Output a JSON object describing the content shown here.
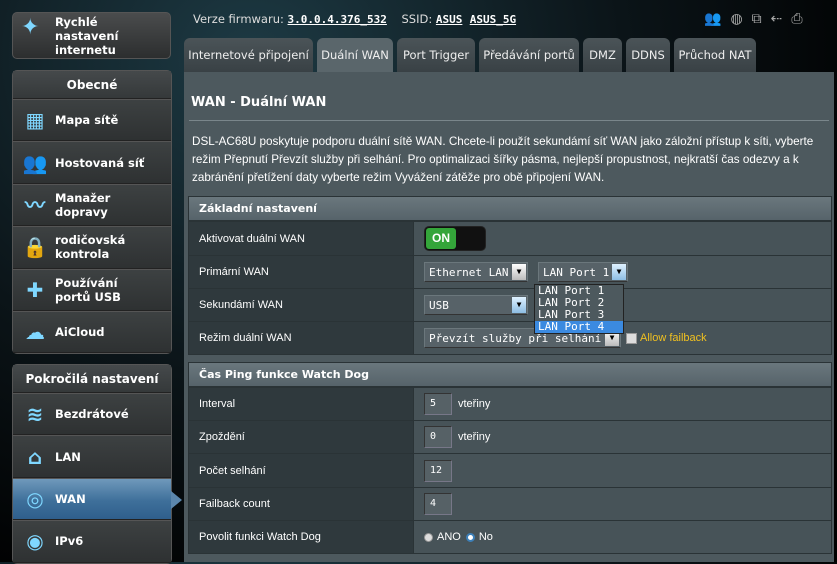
{
  "quick_setup": {
    "label": "Rychlé nastavení internetu",
    "icon": "magic-wand-icon"
  },
  "general": {
    "header": "Obecné",
    "items": [
      {
        "label": "Mapa sítě",
        "icon": "network-map-icon"
      },
      {
        "label": "Hostovaná síť",
        "icon": "guest-network-icon"
      },
      {
        "label": "Manažer dopravy",
        "icon": "traffic-manager-icon"
      },
      {
        "label": "rodičovská kontrola",
        "icon": "lock-icon"
      },
      {
        "label": "Používání portů USB",
        "icon": "puzzle-icon"
      },
      {
        "label": "AiCloud",
        "icon": "cloud-icon"
      }
    ]
  },
  "advanced": {
    "header": "Pokročilá nastavení",
    "items": [
      {
        "label": "Bezdrátové",
        "icon": "wifi-icon"
      },
      {
        "label": "LAN",
        "icon": "home-icon"
      },
      {
        "label": "WAN",
        "icon": "globe-icon",
        "selected": true
      },
      {
        "label": "IPv6",
        "icon": "ipv6-globe-icon"
      }
    ]
  },
  "header": {
    "firmware_label": "Verze firmwaru:",
    "firmware": "3.0.0.4.376_532",
    "ssid_label": "SSID:",
    "ssid1": "ASUS",
    "ssid2": "ASUS_5G",
    "status_icons": [
      "clients-icon",
      "internet-globe-icon",
      "devices-icon",
      "usb-icon",
      "printer-icon"
    ]
  },
  "tabs": [
    "Internetové připojení",
    "Duální WAN",
    "Port Trigger",
    "Předávání portů",
    "DMZ",
    "DDNS",
    "Průchod NAT"
  ],
  "active_tab": "Duální WAN",
  "page": {
    "title": "WAN - Duální WAN",
    "description": "DSL-AC68U poskytuje podporu duální sítě WAN. Chcete-li použít sekundámí síť WAN jako záložní přístup k síti, vyberte režim Přepnutí Převzít služby při selhání. Pro optimalizaci šířky pásma, nejlepší propustnost, nejkratší čas odezvy a k zabránění přetížení daty vyberte režim Vyvážení zátěže pro obě připojení WAN."
  },
  "basic": {
    "header": "Základní nastavení",
    "enable_label": "Aktivovat duální WAN",
    "enable_value": "ON",
    "primary_label": "Primární WAN",
    "primary_value": "Ethernet LAN",
    "primary_port": "LAN Port 1",
    "port_options": [
      "LAN Port 1",
      "LAN Port 2",
      "LAN Port 3",
      "LAN Port 4"
    ],
    "port_highlighted": "LAN Port 4",
    "secondary_label": "Sekundámí WAN",
    "secondary_value": "USB",
    "mode_label": "Režim duální WAN",
    "mode_value": "Převzít služby při selhání",
    "allow_failback": "Allow failback",
    "allow_failback_checked": false
  },
  "watchdog": {
    "header": "Čas Ping funkce Watch Dog",
    "interval_label": "Interval",
    "interval": "5",
    "unit": "vteřiny",
    "delay_label": "Zpoždění",
    "delay": "0",
    "fail_label": "Počet selhání",
    "fail": "12",
    "failback_label": "Failback count",
    "failback": "4",
    "enable_label": "Povolit funkci Watch Dog",
    "yes": "ANO",
    "no": "No",
    "selected": "No"
  },
  "colors": {
    "accent": "#3b8ae0",
    "toggle_on": "#34a53a",
    "failback_text": "#f0c020"
  }
}
